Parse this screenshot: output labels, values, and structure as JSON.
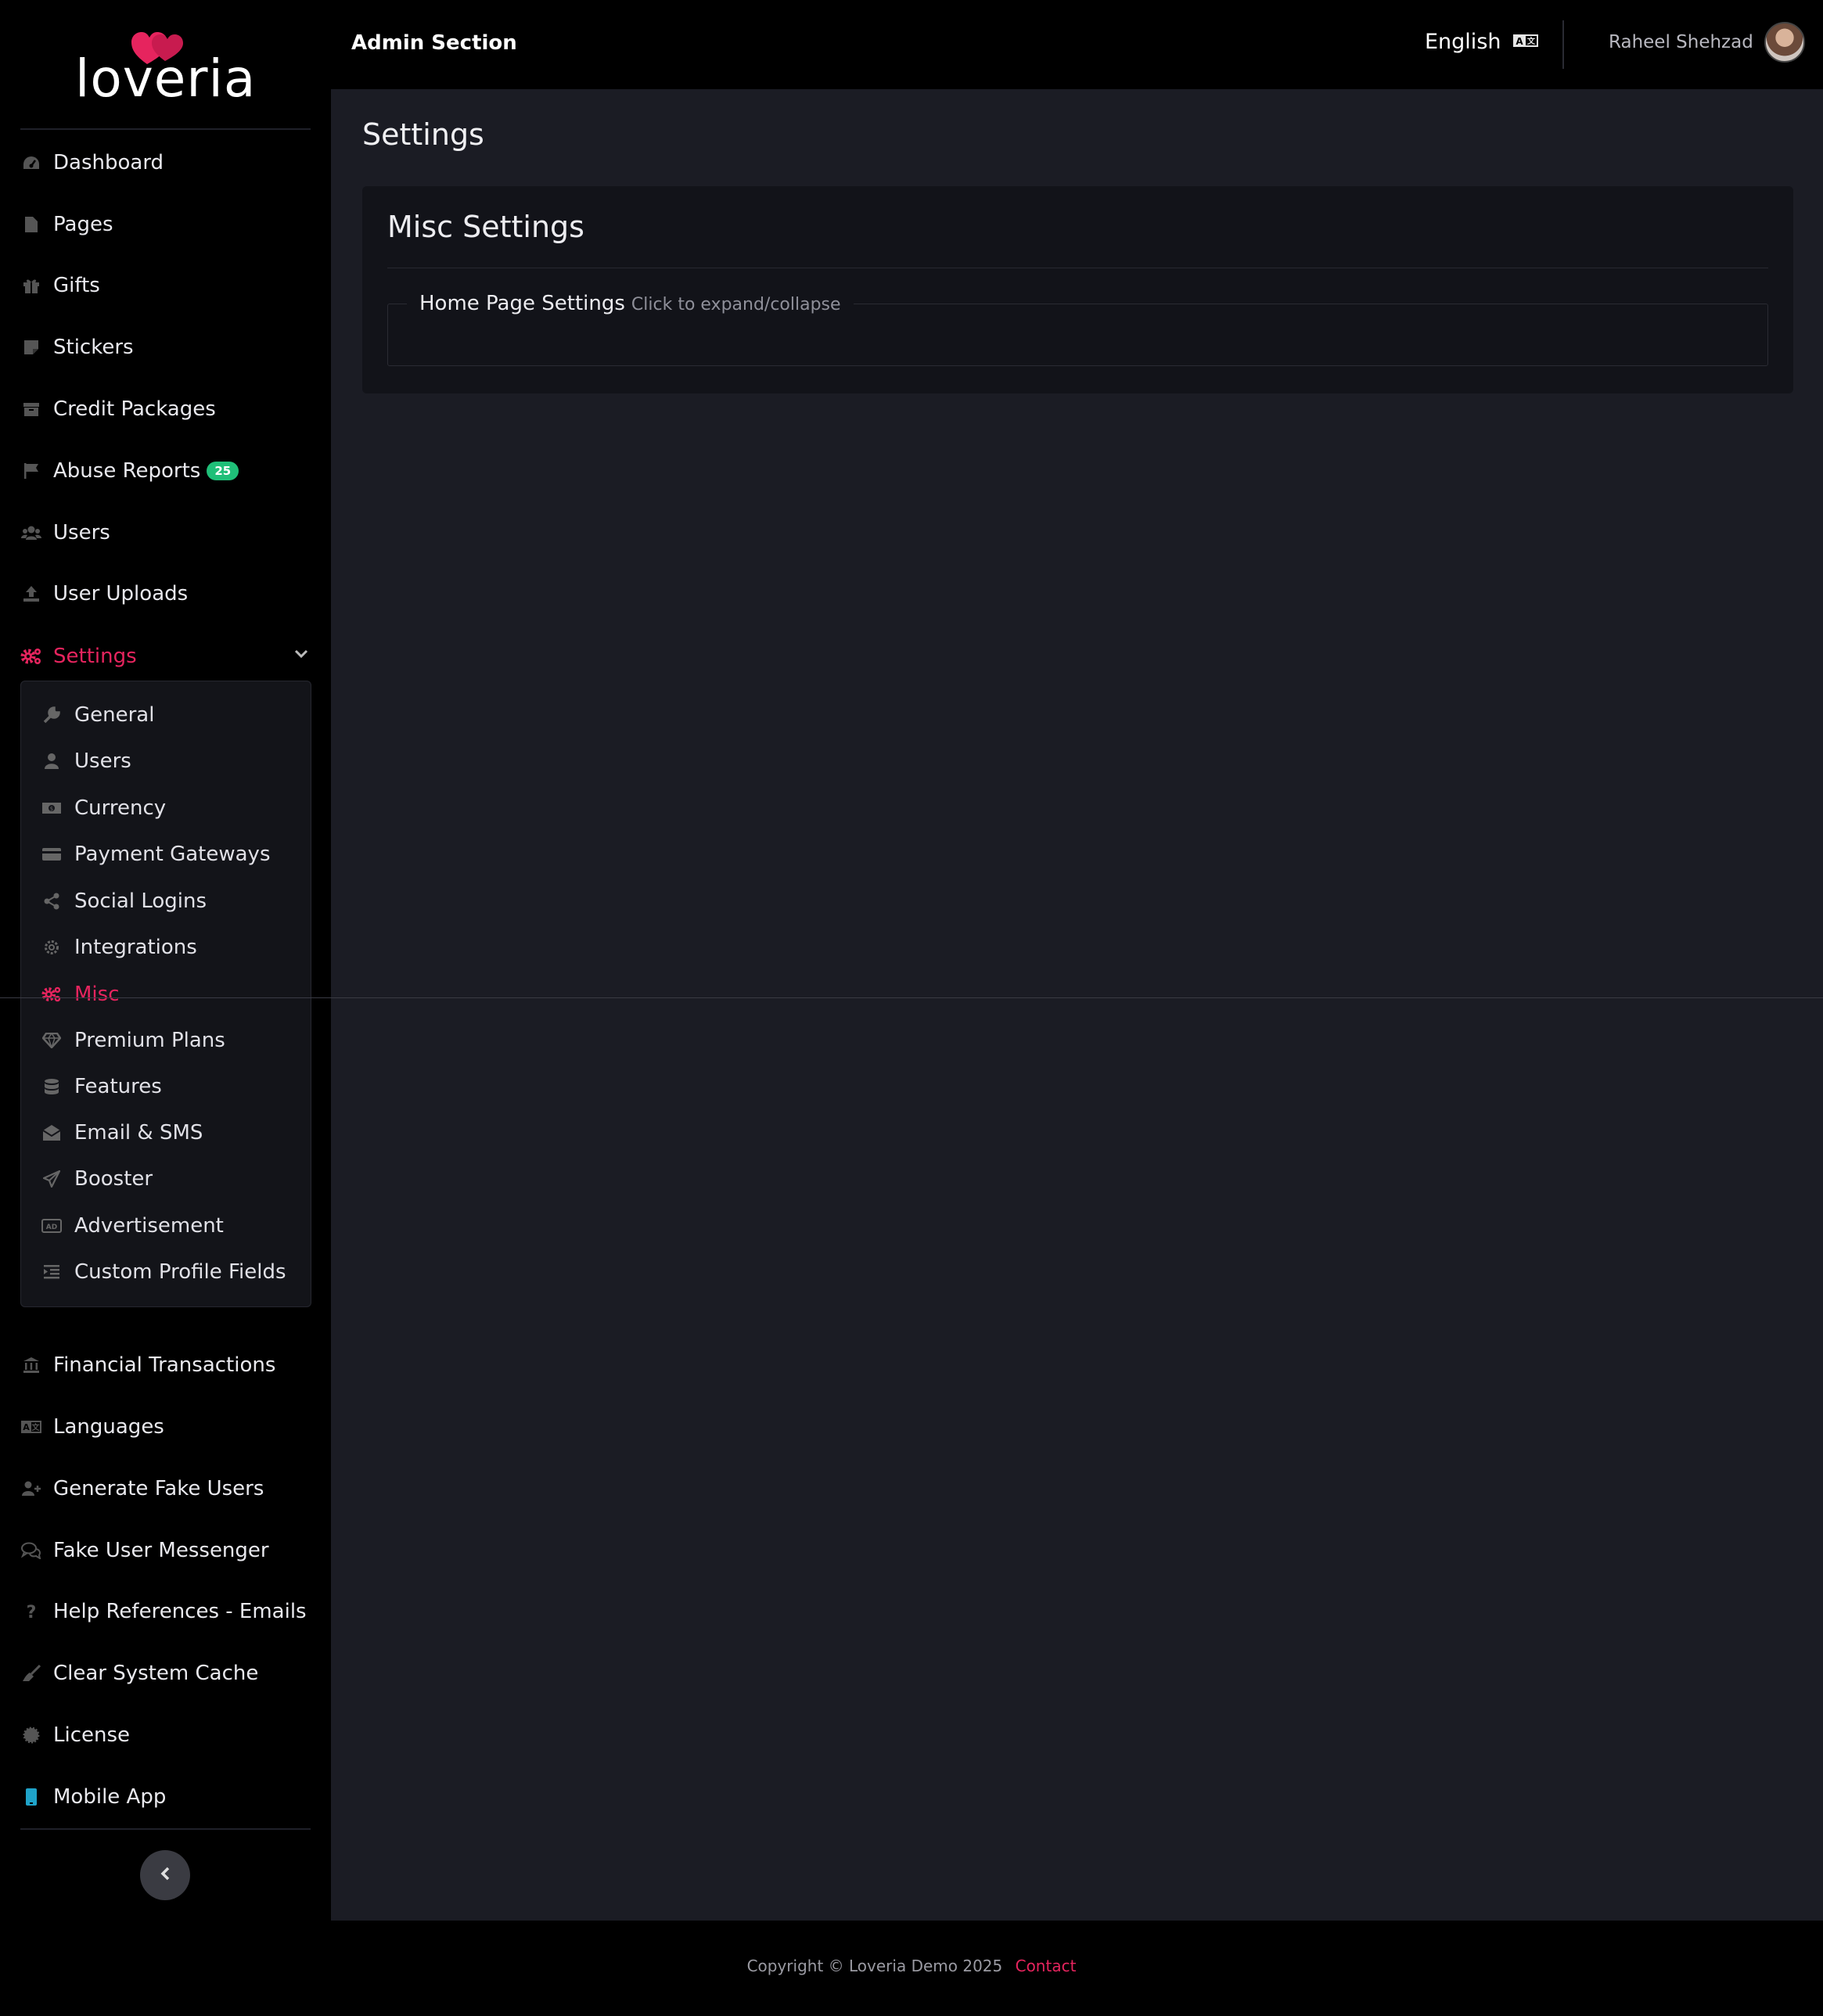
{
  "brand": {
    "logo_text": "loveria",
    "accent": "#e6245e"
  },
  "topbar": {
    "title": "Admin Section",
    "language": "English",
    "language_icon": "language-icon",
    "user_name": "Raheel Shehzad"
  },
  "sidebar": {
    "items": [
      {
        "label": "Dashboard",
        "icon": "dashboard-icon"
      },
      {
        "label": "Pages",
        "icon": "page-icon"
      },
      {
        "label": "Gifts",
        "icon": "gift-icon"
      },
      {
        "label": "Stickers",
        "icon": "sticker-icon"
      },
      {
        "label": "Credit Packages",
        "icon": "box-icon"
      },
      {
        "label": "Abuse Reports",
        "icon": "flag-icon",
        "badge": "25"
      },
      {
        "label": "Users",
        "icon": "users-icon"
      },
      {
        "label": "User Uploads",
        "icon": "upload-icon"
      },
      {
        "label": "Settings",
        "icon": "cogs-icon",
        "active": true
      }
    ],
    "settings_submenu": [
      {
        "label": "General",
        "icon": "wrench-icon"
      },
      {
        "label": "Users",
        "icon": "user-icon"
      },
      {
        "label": "Currency",
        "icon": "money-icon"
      },
      {
        "label": "Payment Gateways",
        "icon": "credit-card-icon"
      },
      {
        "label": "Social Logins",
        "icon": "share-icon"
      },
      {
        "label": "Integrations",
        "icon": "gear-icon"
      },
      {
        "label": "Misc",
        "icon": "cogs-icon",
        "active": true
      },
      {
        "label": "Premium Plans",
        "icon": "diamond-icon"
      },
      {
        "label": "Features",
        "icon": "database-icon"
      },
      {
        "label": "Email & SMS",
        "icon": "envelope-icon"
      },
      {
        "label": "Booster",
        "icon": "paper-plane-icon"
      },
      {
        "label": "Advertisement",
        "icon": "ad-icon"
      },
      {
        "label": "Custom Profile Fields",
        "icon": "list-indent-icon"
      }
    ],
    "bottom_items": [
      {
        "label": "Financial Transactions",
        "icon": "bank-icon"
      },
      {
        "label": "Languages",
        "icon": "language-icon"
      },
      {
        "label": "Generate Fake Users",
        "icon": "user-plus-icon"
      },
      {
        "label": "Fake User Messenger",
        "icon": "comments-icon"
      },
      {
        "label": "Help References - Emails",
        "icon": "question-icon"
      },
      {
        "label": "Clear System Cache",
        "icon": "broom-icon"
      },
      {
        "label": "License",
        "icon": "certificate-icon"
      },
      {
        "label": "Mobile App",
        "icon": "mobile-icon"
      }
    ]
  },
  "main": {
    "page_title": "Settings",
    "card_title": "Misc Settings",
    "section_title": "Home Page Settings",
    "section_hint": "Click to expand/collapse"
  },
  "footer": {
    "copyright": "Copyright © Loveria Demo 2025",
    "contact": "Contact"
  }
}
